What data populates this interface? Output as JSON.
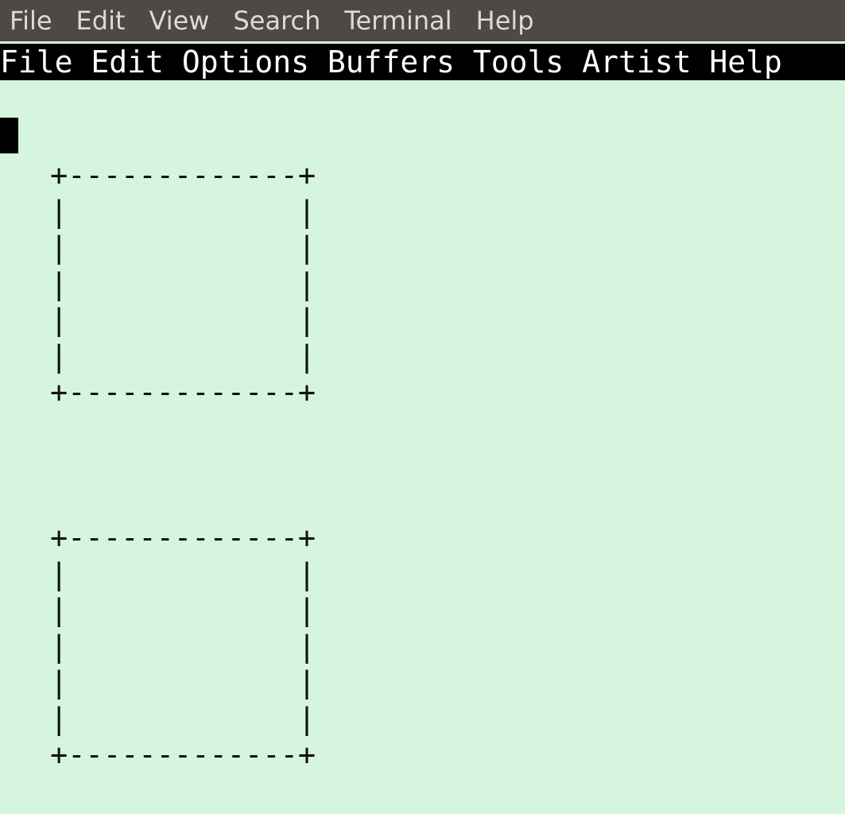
{
  "terminal_menu": {
    "items": [
      "File",
      "Edit",
      "View",
      "Search",
      "Terminal",
      "Help"
    ]
  },
  "emacs_menu": {
    "items": [
      "File",
      "Edit",
      "Options",
      "Buffers",
      "Tools",
      "Artist",
      "Help"
    ]
  },
  "buffer": {
    "boxes": [
      "+-------------+\n|             |\n|             |\n|             |\n|             |\n|             |\n+-------------+",
      "+-------------+\n|             |\n|             |\n|             |\n|             |\n|             |\n+-------------+"
    ]
  },
  "colors": {
    "terminal_menubar_bg": "#4e4944",
    "terminal_menubar_fg": "#dcdcd5",
    "emacs_menubar_bg": "#000000",
    "emacs_menubar_fg": "#ffffff",
    "buffer_bg": "#d5f5df",
    "text": "#111111",
    "cursor": "#000000"
  }
}
